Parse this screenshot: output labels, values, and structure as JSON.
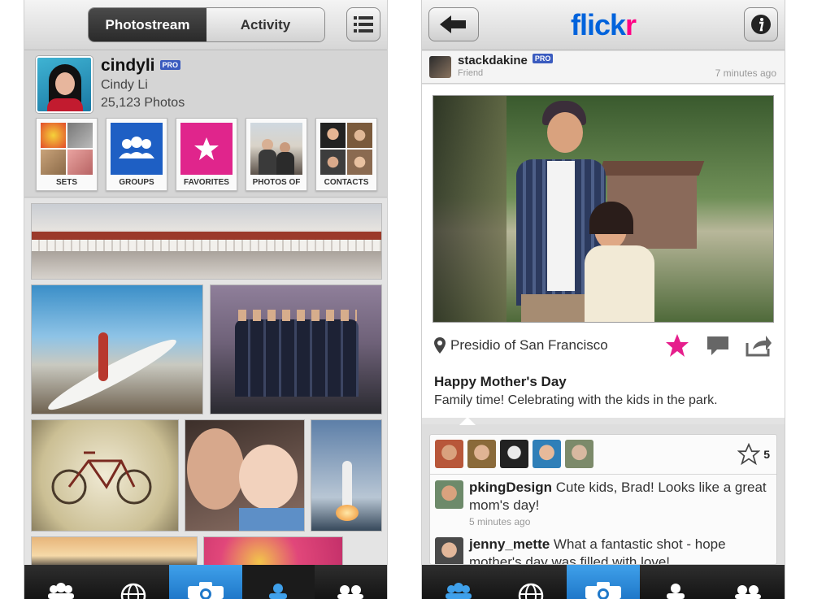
{
  "left_screen": {
    "segmented": {
      "photostream": "Photostream",
      "activity": "Activity"
    },
    "profile": {
      "username": "cindyli",
      "pro_badge": "PRO",
      "real_name": "Cindy Li",
      "photo_count": "25,123 Photos"
    },
    "tiles": [
      {
        "label": "SETS"
      },
      {
        "label": "GROUPS"
      },
      {
        "label": "FAVORITES"
      },
      {
        "label": "PHOTOS OF"
      },
      {
        "label": "CONTACTS"
      }
    ],
    "tabbar": [
      "people-icon",
      "globe-icon",
      "camera-icon",
      "person-icon",
      "contacts-icon"
    ],
    "selected_tab": "camera-icon"
  },
  "right_screen": {
    "logo": {
      "part1": "flick",
      "part2": "r"
    },
    "post": {
      "username": "stackdakine",
      "pro_badge": "PRO",
      "relation": "Friend",
      "time": "7 minutes ago",
      "location": "Presidio of San Francisco",
      "title": "Happy Mother's Day",
      "caption": "Family time! Celebrating with the kids in the park."
    },
    "favorites_count": "5",
    "comments": [
      {
        "user": "pkingDesign",
        "text": " Cute kids, Brad! Looks like a great mom's day!",
        "time": "5 minutes ago"
      },
      {
        "user": "jenny_mette",
        "text": " What a fantastic shot - hope mother's day was filled with love!"
      }
    ],
    "tabbar": [
      "people-icon",
      "globe-icon",
      "camera-icon",
      "person-icon",
      "contacts-icon"
    ],
    "selected_tab": "camera-icon"
  },
  "colors": {
    "flickr_blue": "#0063dc",
    "flickr_pink": "#ff0084",
    "pro_badge": "#3a5bbf",
    "tab_selected": "#1f78c9",
    "favorite_star": "#e61e8c"
  }
}
